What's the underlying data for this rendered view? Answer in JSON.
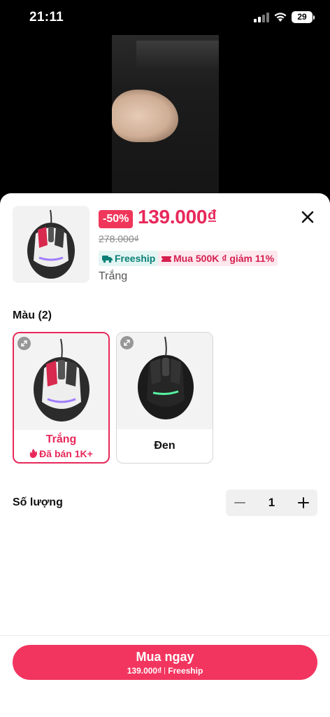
{
  "status_bar": {
    "time": "21:11",
    "battery": "29"
  },
  "product": {
    "discount": "-50%",
    "price": "139.000₫",
    "original_price": "278.000₫",
    "tags": {
      "freeship": "Freeship",
      "promo": "Mua 500K ₫ giảm 11%"
    },
    "selected_variant": "Trắng"
  },
  "color_section": {
    "label": "Màu (2)",
    "options": [
      {
        "name": "Trắng",
        "sold": "Đã bán 1K+",
        "selected": true
      },
      {
        "name": "Đen",
        "selected": false
      }
    ]
  },
  "quantity": {
    "label": "Số lượng",
    "value": "1"
  },
  "buy_button": {
    "label": "Mua ngay",
    "price": "139.000₫",
    "shipping": "Freeship"
  },
  "colors": {
    "accent": "#f2355f",
    "freeship_bg": "#e2f5f3",
    "freeship_text": "#0a7f76",
    "promo_bg": "#fde8ee"
  },
  "icons": [
    "close-icon",
    "truck-icon",
    "ticket-icon",
    "expand-icon",
    "fire-icon",
    "minus-icon",
    "plus-icon"
  ]
}
